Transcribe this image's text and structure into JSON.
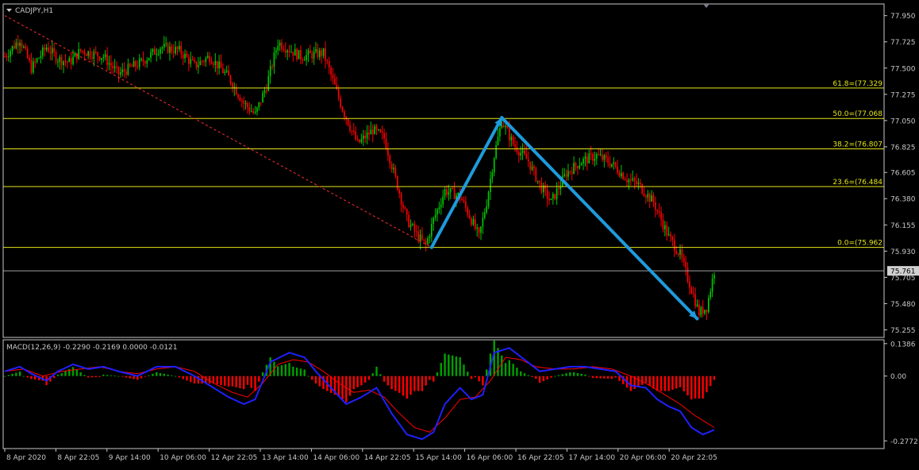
{
  "window": {
    "symbol_label": "CADJPY,H1",
    "menu_icon": "triangle-down-icon"
  },
  "colors": {
    "background": "#000000",
    "axis": "#c8c8c8",
    "bull_candle": "#00c800",
    "bear_candle": "#ff0000",
    "fib_line": "#e6e619",
    "trend_line": "#ff3030",
    "arrow": "#1e9bdc",
    "macd_line": "#2020ff",
    "signal_line": "#ff0000",
    "hist_pos": "#00a000",
    "hist_neg": "#ff0000",
    "current_price_line": "#a0a0a0"
  },
  "price_axis": {
    "labels": [
      "77.950",
      "77.725",
      "77.500",
      "77.275",
      "77.050",
      "76.825",
      "76.605",
      "76.380",
      "76.155",
      "75.930",
      "75.705",
      "75.480",
      "75.255"
    ],
    "current_price": "75.761"
  },
  "time_axis": {
    "labels": [
      "8 Apr 2020",
      "8 Apr 22:05",
      "9 Apr 14:00",
      "10 Apr 06:00",
      "12 Apr 22:05",
      "13 Apr 14:00",
      "14 Apr 06:00",
      "14 Apr 22:05",
      "15 Apr 14:00",
      "16 Apr 06:00",
      "16 Apr 22:05",
      "17 Apr 14:00",
      "20 Apr 06:00",
      "20 Apr 22:05"
    ]
  },
  "fibonacci": {
    "levels": [
      {
        "label": "61.8=(77.329",
        "price": 77.329
      },
      {
        "label": "50.0=(77.068",
        "price": 77.068
      },
      {
        "label": "38.2=(76.807",
        "price": 76.807
      },
      {
        "label": "23.6=(76.484",
        "price": 76.484
      },
      {
        "label": "0.0=(75.962",
        "price": 75.962
      }
    ]
  },
  "macd": {
    "label": "MACD(12,26,9) -0.2290 -0.2169 0.0000 -0.0121",
    "axis_labels": [
      "0.1386",
      "0.00",
      "-0.2772"
    ]
  },
  "chart_data": {
    "type": "candlestick",
    "title": "CADJPY,H1",
    "ylim": [
      75.19,
      78.05
    ],
    "close_path": [
      [
        0,
        77.6
      ],
      [
        8,
        77.75
      ],
      [
        14,
        77.5
      ],
      [
        22,
        77.68
      ],
      [
        28,
        77.58
      ],
      [
        34,
        77.55
      ],
      [
        40,
        77.65
      ],
      [
        52,
        77.6
      ],
      [
        60,
        77.45
      ],
      [
        72,
        77.55
      ],
      [
        82,
        77.68
      ],
      [
        92,
        77.65
      ],
      [
        100,
        77.52
      ],
      [
        108,
        77.6
      ],
      [
        118,
        77.42
      ],
      [
        126,
        77.2
      ],
      [
        132,
        77.1
      ],
      [
        138,
        77.35
      ],
      [
        144,
        77.72
      ],
      [
        156,
        77.6
      ],
      [
        168,
        77.63
      ],
      [
        178,
        77.15
      ],
      [
        186,
        76.85
      ],
      [
        194,
        76.97
      ],
      [
        200,
        76.9
      ],
      [
        206,
        76.55
      ],
      [
        212,
        76.2
      ],
      [
        218,
        76.05
      ],
      [
        222,
        75.98
      ],
      [
        226,
        76.2
      ],
      [
        232,
        76.45
      ],
      [
        240,
        76.4
      ],
      [
        246,
        76.2
      ],
      [
        250,
        76.05
      ],
      [
        254,
        76.35
      ],
      [
        258,
        76.75
      ],
      [
        262,
        77.05
      ],
      [
        268,
        76.85
      ],
      [
        276,
        76.7
      ],
      [
        282,
        76.5
      ],
      [
        288,
        76.35
      ],
      [
        296,
        76.6
      ],
      [
        304,
        76.7
      ],
      [
        312,
        76.75
      ],
      [
        320,
        76.68
      ],
      [
        328,
        76.55
      ],
      [
        334,
        76.5
      ],
      [
        342,
        76.35
      ],
      [
        350,
        76.05
      ],
      [
        356,
        75.9
      ],
      [
        362,
        75.6
      ],
      [
        366,
        75.4
      ],
      [
        370,
        75.45
      ],
      [
        374,
        75.76
      ]
    ],
    "arrows": [
      {
        "from": [
          225,
          75.962
        ],
        "to": [
          262,
          77.075
        ]
      },
      {
        "from": [
          262,
          77.075
        ],
        "to": [
          365,
          75.35
        ]
      }
    ],
    "trendline": {
      "from": [
        0,
        77.95
      ],
      "to": [
        225,
        75.962
      ]
    },
    "macd_main_path": [
      [
        0,
        0.02
      ],
      [
        8,
        0.04
      ],
      [
        14,
        0.01
      ],
      [
        22,
        -0.02
      ],
      [
        28,
        0.02
      ],
      [
        36,
        0.05
      ],
      [
        44,
        0.03
      ],
      [
        52,
        0.04
      ],
      [
        60,
        0.02
      ],
      [
        70,
        0.0
      ],
      [
        80,
        0.04
      ],
      [
        90,
        0.04
      ],
      [
        100,
        0.0
      ],
      [
        110,
        -0.05
      ],
      [
        118,
        -0.09
      ],
      [
        126,
        -0.12
      ],
      [
        132,
        -0.1
      ],
      [
        140,
        0.06
      ],
      [
        150,
        0.1
      ],
      [
        158,
        0.08
      ],
      [
        164,
        0.02
      ],
      [
        172,
        -0.05
      ],
      [
        180,
        -0.12
      ],
      [
        188,
        -0.09
      ],
      [
        196,
        -0.05
      ],
      [
        204,
        -0.16
      ],
      [
        212,
        -0.25
      ],
      [
        220,
        -0.27
      ],
      [
        226,
        -0.24
      ],
      [
        232,
        -0.12
      ],
      [
        240,
        -0.05
      ],
      [
        246,
        -0.1
      ],
      [
        252,
        -0.08
      ],
      [
        258,
        0.1
      ],
      [
        266,
        0.12
      ],
      [
        274,
        0.07
      ],
      [
        282,
        0.02
      ],
      [
        290,
        0.03
      ],
      [
        298,
        0.04
      ],
      [
        306,
        0.04
      ],
      [
        314,
        0.03
      ],
      [
        322,
        0.02
      ],
      [
        330,
        -0.04
      ],
      [
        338,
        -0.05
      ],
      [
        344,
        -0.1
      ],
      [
        350,
        -0.13
      ],
      [
        356,
        -0.15
      ],
      [
        362,
        -0.22
      ],
      [
        368,
        -0.25
      ],
      [
        374,
        -0.23
      ]
    ],
    "macd_signal_path": [
      [
        0,
        0.02
      ],
      [
        10,
        0.03
      ],
      [
        20,
        0.0
      ],
      [
        30,
        0.02
      ],
      [
        40,
        0.03
      ],
      [
        50,
        0.04
      ],
      [
        60,
        0.02
      ],
      [
        70,
        0.01
      ],
      [
        80,
        0.03
      ],
      [
        90,
        0.04
      ],
      [
        100,
        0.02
      ],
      [
        110,
        -0.03
      ],
      [
        120,
        -0.07
      ],
      [
        128,
        -0.09
      ],
      [
        136,
        -0.03
      ],
      [
        144,
        0.05
      ],
      [
        152,
        0.07
      ],
      [
        160,
        0.06
      ],
      [
        168,
        0.02
      ],
      [
        176,
        -0.03
      ],
      [
        184,
        -0.07
      ],
      [
        192,
        -0.06
      ],
      [
        200,
        -0.09
      ],
      [
        208,
        -0.16
      ],
      [
        216,
        -0.22
      ],
      [
        224,
        -0.24
      ],
      [
        232,
        -0.18
      ],
      [
        240,
        -0.1
      ],
      [
        248,
        -0.09
      ],
      [
        256,
        -0.02
      ],
      [
        264,
        0.08
      ],
      [
        272,
        0.07
      ],
      [
        280,
        0.04
      ],
      [
        290,
        0.03
      ],
      [
        300,
        0.03
      ],
      [
        310,
        0.04
      ],
      [
        320,
        0.03
      ],
      [
        330,
        0.0
      ],
      [
        340,
        -0.04
      ],
      [
        348,
        -0.08
      ],
      [
        356,
        -0.12
      ],
      [
        364,
        -0.17
      ],
      [
        370,
        -0.2
      ],
      [
        374,
        -0.22
      ]
    ]
  }
}
